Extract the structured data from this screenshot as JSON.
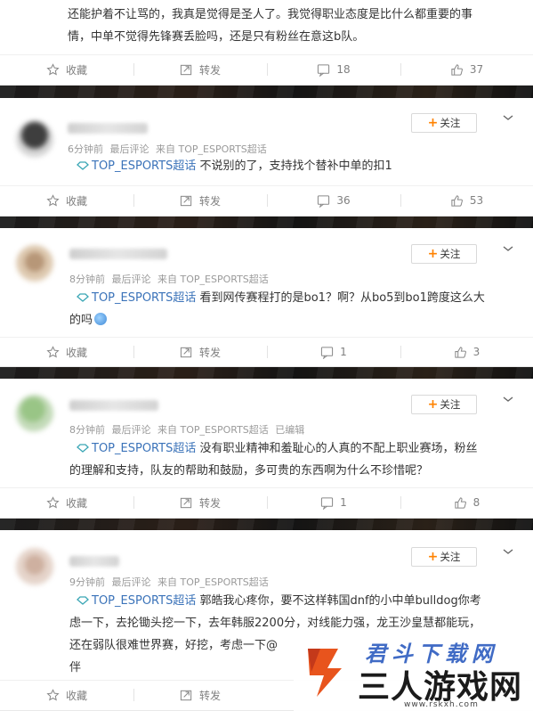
{
  "actions": {
    "collect": "收藏",
    "repost": "转发"
  },
  "follow_label": "关注",
  "cards": [
    {
      "text_lines": [
        "还能护着不让骂的，我真是觉得是圣人了。我觉得职业态度是比什么都重要的事",
        "情，中单不觉得先锋赛丢脸吗，还是只有粉丝在意这b队。"
      ],
      "comments": "18",
      "likes": "37"
    },
    {
      "time": "6分钟前",
      "last_comment": "最后评论",
      "source": "来自 TOP_ESPORTS超话",
      "topic": "TOP_ESPORTS超话",
      "text": " 不说别的了，支持找个替补中单的扣1",
      "comments": "36",
      "likes": "53"
    },
    {
      "time": "8分钟前",
      "last_comment": "最后评论",
      "source": "来自 TOP_ESPORTS超话",
      "topic": "TOP_ESPORTS超话",
      "text": " 看到网传赛程打的是bo1？啊？从bo5到bo1跨度这么大",
      "text2": "的吗",
      "comments": "1",
      "likes": "3"
    },
    {
      "time": "8分钟前",
      "last_comment": "最后评论",
      "source": "来自 TOP_ESPORTS超话",
      "edited": "已编辑",
      "topic": "TOP_ESPORTS超话",
      "text": " 没有职业精神和羞耻心的人真的不配上职业赛场，粉丝",
      "text2": "的理解和支持，队友的帮助和鼓励，多可贵的东西啊为什么不珍惜呢？",
      "comments": "1",
      "likes": "8"
    },
    {
      "time": "9分钟前",
      "last_comment": "最后评论",
      "source": "来自 TOP_ESPORTS超话",
      "topic": "TOP_ESPORTS超话",
      "text": " 郭皓我心疼你，要不这样韩国dnf的小中单bulldog你考",
      "text2": "虑一下，去抡锄头挖一下，去年韩服2200分，对线能力强，龙王沙皇慧都能玩，",
      "text3": "还在弱队很难世界赛，好挖，考虑一下@",
      "text4": "伴"
    }
  ],
  "watermark": {
    "top": "君斗下载网",
    "big": "三人游戏网",
    "url": "www.rskxh.com"
  },
  "colors": {
    "topic": "#3b73b9",
    "follow_plus": "#ff8200",
    "meta": "#9a9a9a"
  }
}
